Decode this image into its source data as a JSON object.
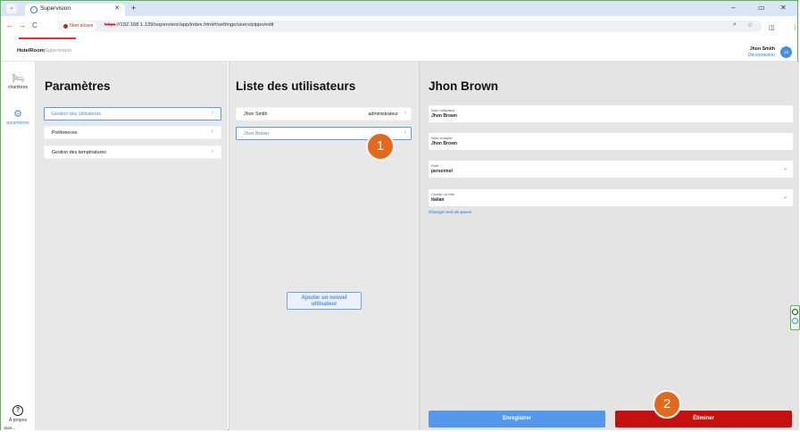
{
  "browser": {
    "tab_title": "Supervision",
    "not_secure": "Non sicuro",
    "url_scheme": "https",
    "url_rest": "://192.168.1.139/supervisor/app/index.html#/settings/users/pippo/edit"
  },
  "header": {
    "brand_bold": "HotelRoom",
    "brand_light": "Supervision",
    "user_name": "Jhon Smith",
    "logout": "Déconnexion",
    "avatar": "JS"
  },
  "sidebar": {
    "items": [
      {
        "label": "chambres",
        "icon": "bed-icon"
      },
      {
        "label": "paramètres",
        "icon": "gear-icon"
      }
    ],
    "help_label": "À propos",
    "start_label": "Start..."
  },
  "settings": {
    "title": "Paramètres",
    "items": [
      {
        "label": "Gestion des utilisateurs"
      },
      {
        "label": "Préférences"
      },
      {
        "label": "Gestion des températures"
      }
    ]
  },
  "users": {
    "title": "Liste des utilisateurs",
    "list": [
      {
        "name": "Jhon Smith",
        "role": "administrateur"
      },
      {
        "name": "Jhon Brown",
        "role": ""
      }
    ],
    "add_button_line1": "Ajouter un nouvel",
    "add_button_line2": "utilisateur"
  },
  "detail": {
    "title": "Jhon Brown",
    "fields": [
      {
        "label": "Nom utilisateur",
        "value": "Jhon Brown"
      },
      {
        "label": "Nom complet",
        "value": "Jhon Brown"
      },
      {
        "label": "Rôle",
        "value": "personnel"
      },
      {
        "label": "Choisir un rôle",
        "value": "italian"
      }
    ],
    "change_password": "Changer mot de passe",
    "save_button": "Enregistrer",
    "delete_button": "Éliminer"
  },
  "callouts": [
    "1",
    "2"
  ],
  "colors": {
    "accent": "#4a8ee0",
    "danger": "#c60f0f",
    "callout": "#e26a1a"
  }
}
